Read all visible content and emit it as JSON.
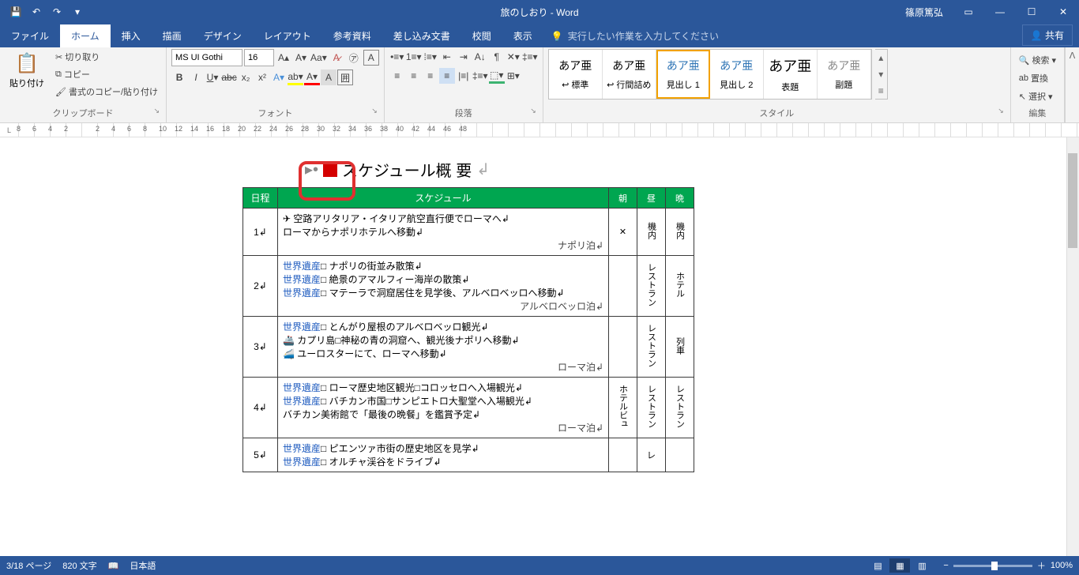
{
  "title": {
    "doc": "旅のしおり - Word",
    "user": "篠原篤弘"
  },
  "qat": {
    "save": "save",
    "undo": "undo",
    "redo": "redo",
    "more": "more"
  },
  "tabs": {
    "file": "ファイル",
    "home": "ホーム",
    "insert": "挿入",
    "draw": "描画",
    "design": "デザイン",
    "layout": "レイアウト",
    "references": "参考資料",
    "mailings": "差し込み文書",
    "review": "校閲",
    "view": "表示",
    "tellme": "実行したい作業を入力してください",
    "share": "共有"
  },
  "ribbon": {
    "clipboard": {
      "paste": "貼り付け",
      "cut": "切り取り",
      "copy": "コピー",
      "painter": "書式のコピー/貼り付け",
      "label": "クリップボード"
    },
    "font": {
      "name": "MS UI Gothi",
      "size": "16",
      "label": "フォント"
    },
    "para": {
      "label": "段落"
    },
    "styles": {
      "label": "スタイル",
      "items": [
        {
          "prev": "あア亜",
          "name": "↩ 標準"
        },
        {
          "prev": "あア亜",
          "name": "↩ 行間詰め"
        },
        {
          "prev": "あア亜",
          "name": "見出し 1"
        },
        {
          "prev": "あア亜",
          "name": "見出し 2"
        },
        {
          "prev": "あア亜",
          "name": "表題"
        },
        {
          "prev": "あア亜",
          "name": "副題"
        }
      ]
    },
    "editing": {
      "find": "検索",
      "replace": "置換",
      "select": "選択",
      "label": "編集"
    }
  },
  "ruler": [
    "8",
    "6",
    "4",
    "2",
    "",
    "2",
    "4",
    "6",
    "8",
    "10",
    "12",
    "14",
    "16",
    "18",
    "20",
    "22",
    "24",
    "26",
    "28",
    "30",
    "32",
    "34",
    "36",
    "38",
    "40",
    "42",
    "44",
    "46",
    "48"
  ],
  "doc": {
    "heading": "スケジュール概 要",
    "headers": {
      "day": "日程",
      "sched": "スケジュール",
      "morning": "朝",
      "noon": "昼",
      "night": "晩"
    },
    "rows": [
      {
        "day": "1",
        "lines": [
          {
            "t": "✈ 空路アリタリア・イタリア航空直行便でローマへ"
          },
          {
            "t": "ローマからナポリホテルへ移動"
          }
        ],
        "stay": "ナポリ泊",
        "m": "✕",
        "n": "機内",
        "e": "機内"
      },
      {
        "day": "2",
        "lines": [
          {
            "w": true,
            "t": "□ ナポリの街並み散策"
          },
          {
            "w": true,
            "t": "□ 絶景のアマルフィー海岸の散策"
          },
          {
            "w": true,
            "t": "□ マテーラで洞窟居住を見学後、アルベロベッロへ移動"
          }
        ],
        "stay": "アルベロベッロ泊",
        "m": "",
        "n": "レストラン",
        "e": "ホテル"
      },
      {
        "day": "3",
        "lines": [
          {
            "w": true,
            "t": "□ とんがり屋根のアルベロベッロ観光"
          },
          {
            "t": "🚢 カプリ島□神秘の青の洞窟へ、観光後ナポリへ移動"
          },
          {
            "t": "🚄 ユーロスターにて、ローマへ移動"
          }
        ],
        "stay": "ローマ泊",
        "m": "",
        "n": "レストラン",
        "e": "列車"
      },
      {
        "day": "4",
        "lines": [
          {
            "w": true,
            "t": "□ ローマ歴史地区観光□コロッセロへ入場観光"
          },
          {
            "w": true,
            "t": "□ バチカン市国□サンピエトロ大聖堂へ入場観光"
          },
          {
            "t": "バチカン美術館で「最後の晩餐」を鑑賞予定"
          }
        ],
        "stay": "ローマ泊",
        "m": "ホテルビュ",
        "n": "レストラン",
        "e": "レストラン"
      },
      {
        "day": "5",
        "lines": [
          {
            "w": true,
            "t": "□ ピエンツァ市街の歴史地区を見学"
          },
          {
            "w": true,
            "t": "□ オルチャ渓谷をドライブ"
          }
        ],
        "stay": "",
        "m": "",
        "n": "レ",
        "e": ""
      }
    ]
  },
  "status": {
    "page": "3/18 ページ",
    "words": "820 文字",
    "lang": "日本語",
    "zoom": "100%"
  }
}
